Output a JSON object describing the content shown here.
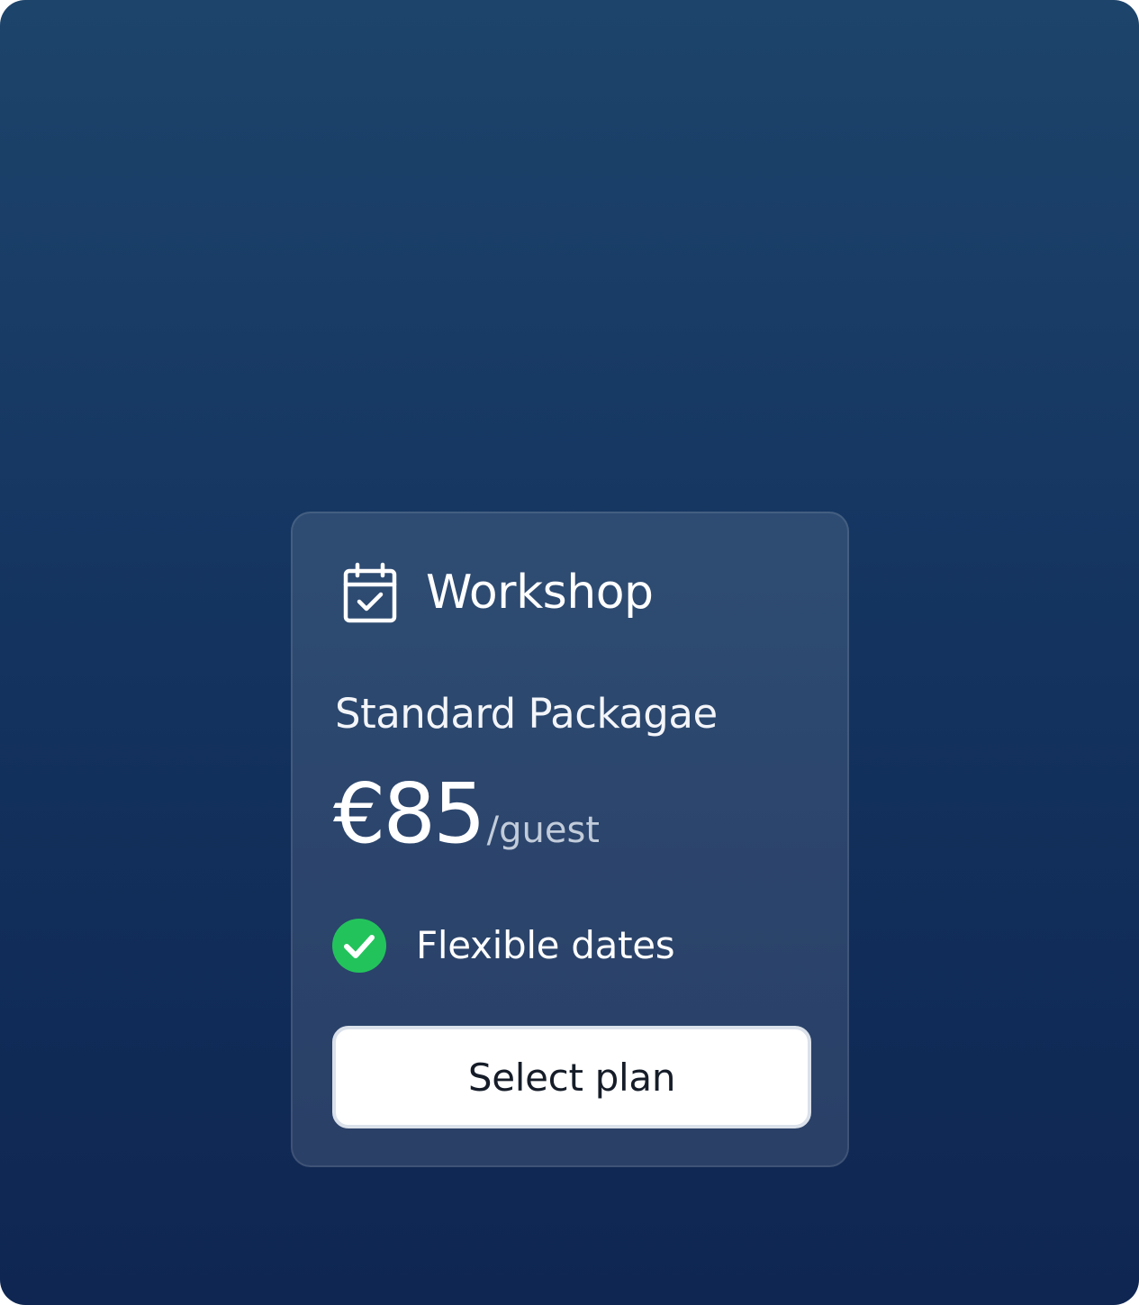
{
  "card": {
    "icon": "calendar-check-icon",
    "title": "Workshop",
    "package": "Standard Packagae",
    "price": "€85",
    "price_unit": "/guest",
    "features": [
      {
        "icon": "check-circle-icon",
        "label": "Flexible dates"
      }
    ],
    "cta_label": "Select plan"
  },
  "colors": {
    "background_top": "#1d446b",
    "background_bottom": "#0f2652",
    "check_green": "#23c35c",
    "button_bg": "#ffffff",
    "button_text": "#161d29"
  }
}
